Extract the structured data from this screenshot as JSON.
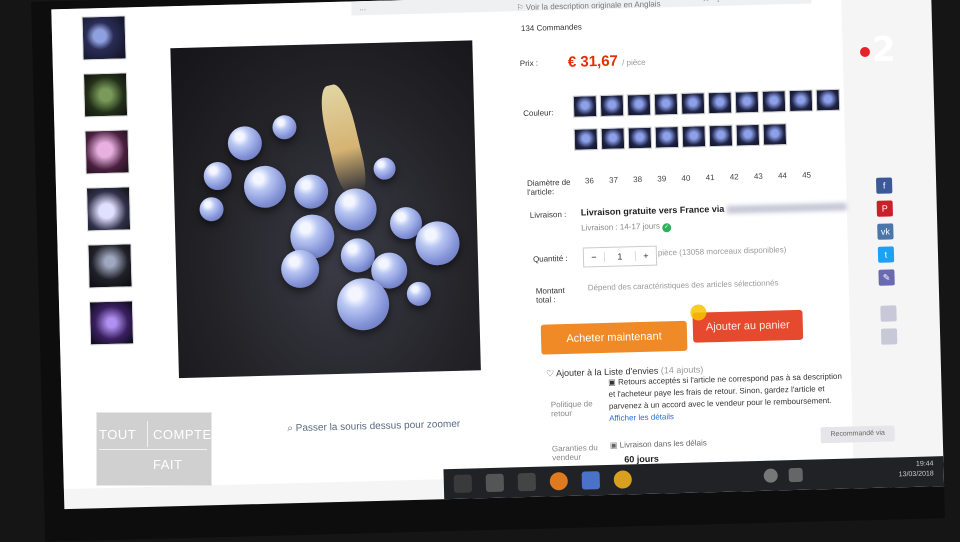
{
  "browser": {
    "url_fragment": "...",
    "top_icons": "☆ ⋮"
  },
  "gallery": {
    "zoom_hint": "Passer la souris dessus pour zoomer"
  },
  "product": {
    "translate_link": "Voir la description originale en Anglais",
    "orders": "134 Commandes",
    "price_label": "Prix :",
    "price": "€ 31,67",
    "price_unit": "/ pièce",
    "color_label": "Couleur:",
    "diameter_label": "Diamètre de l'article:",
    "sizes": [
      "36",
      "37",
      "38",
      "39",
      "40",
      "41",
      "42",
      "43",
      "44",
      "45"
    ],
    "delivery_label": "Livraison :",
    "delivery_value": "Livraison gratuite vers France via",
    "delivery_time": "Livraison : 14-17 jours",
    "quantity_label": "Quantité :",
    "quantity_minus": "−",
    "quantity_value": "1",
    "quantity_plus": "+",
    "availability": "pièce (13058 morceaux disponibles)",
    "total_label": "Montant total :",
    "total_note": "Dépend des caractéristiques des articles sélectionnés",
    "buy_now": "Acheter maintenant",
    "add_to_cart": "Ajouter au panier",
    "wishlist": "Ajouter à la Liste d'envies",
    "wishlist_count": "(14 ajouts)",
    "return_policy_label": "Politique de retour",
    "return_policy_text": "Retours acceptés si l'article ne correspond pas à sa description et l'acheteur paye les frais de retour. Sinon, gardez l'article et parvenez à un accord avec le vendeur pour le remboursement.",
    "return_policy_link": "Afficher les détails",
    "guarantee_label": "Garanties du vendeur",
    "guarantee_text": "Livraison dans les délais",
    "guarantee_days": "60 jours"
  },
  "share": {
    "facebook": "f",
    "pinterest": "P",
    "vk": "vk",
    "twitter": "t",
    "edit": "✎"
  },
  "chat_pill": "Recommandé via",
  "taskbar": {
    "clock_time": "19:44",
    "clock_date": "13/03/2018"
  },
  "overlay": {
    "channel": "2",
    "show_line1": "TOUT",
    "show_line2": "COMPTE",
    "show_line3": "FAIT",
    "channel_dot_color": "#e8202a"
  },
  "colors": {
    "price": "#e62e04",
    "buy_button": "#f08a26",
    "cart_button": "#e64a2e"
  }
}
